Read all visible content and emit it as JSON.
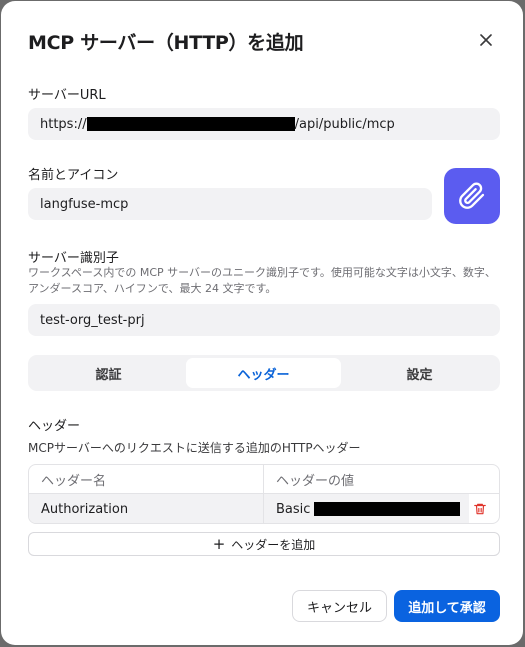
{
  "dialog": {
    "title": "MCP サーバー（HTTP）を追加",
    "close_icon": "close-icon"
  },
  "server_url": {
    "label": "サーバーURL",
    "value_prefix": "https://",
    "value_suffix": "/api/public/mcp"
  },
  "name_icon": {
    "label": "名前とアイコン",
    "value": "langfuse-mcp",
    "icon": "paperclip-icon",
    "icon_color": "#5b5cf0"
  },
  "server_id": {
    "label": "サーバー識別子",
    "help": "ワークスペース内での MCP サーバーのユニーク識別子です。使用可能な文字は小文字、数字、アンダースコア、ハイフンで、最大 24 文字です。",
    "value": "test-org_test-prj"
  },
  "tabs": [
    {
      "label": "認証",
      "active": false
    },
    {
      "label": "ヘッダー",
      "active": true
    },
    {
      "label": "設定",
      "active": false
    }
  ],
  "headers": {
    "label": "ヘッダー",
    "description": "MCPサーバーへのリクエストに送信する追加のHTTPヘッダー",
    "columns": [
      "ヘッダー名",
      "ヘッダーの値"
    ],
    "rows": [
      {
        "name": "Authorization",
        "value_prefix": "Basic"
      }
    ],
    "add_label": "ヘッダーを追加"
  },
  "footer": {
    "cancel_label": "キャンセル",
    "submit_label": "追加して承認"
  },
  "colors": {
    "accent": "#0a63e0",
    "delete": "#e0342b"
  }
}
